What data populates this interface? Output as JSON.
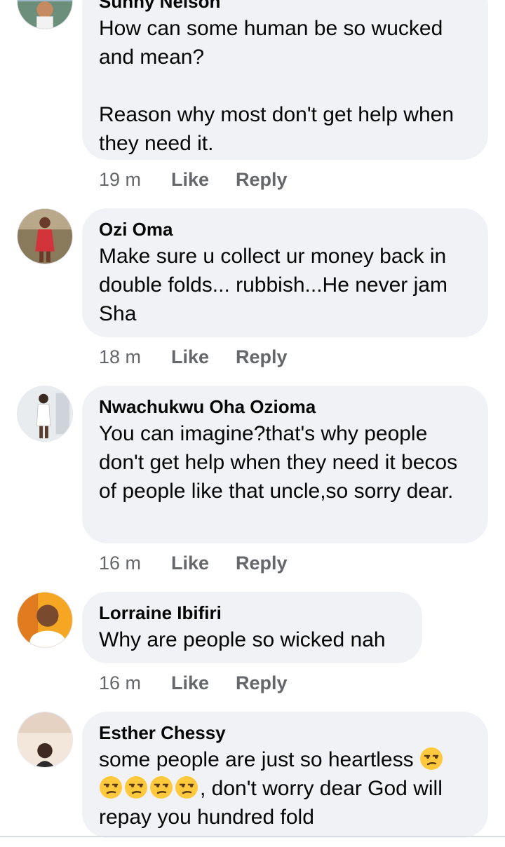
{
  "comments": [
    {
      "name": "Sunny Nelson",
      "text": "How can some human be so wucked and mean?\n\nReason why most don't get help when they need it.",
      "time": "19 m",
      "like_label": "Like",
      "reply_label": "Reply"
    },
    {
      "name": "Ozi Oma",
      "text": "Make sure u collect ur money back in double folds... rubbish...He never jam Sha",
      "time": "18 m",
      "like_label": "Like",
      "reply_label": "Reply"
    },
    {
      "name": "Nwachukwu Oha Ozioma",
      "text": "You can imagine?that's why people don't get help when they need it becos of people like that uncle,so sorry dear.",
      "time": "16 m",
      "like_label": "Like",
      "reply_label": "Reply"
    },
    {
      "name": "Lorraine Ibifiri",
      "text": "Why are people so wicked nah",
      "time": "16 m",
      "like_label": "Like",
      "reply_label": "Reply"
    },
    {
      "name": "Esther Chessy",
      "text_line1": "some people are just so heartless",
      "text_line2": ", don't worry dear God will",
      "text_line3": "repay you hundred fold",
      "emoji_icon": "unamused-face-icon"
    }
  ],
  "colors": {
    "bubble": "#f0f2f5",
    "meta": "#65676b",
    "text": "#050505"
  }
}
